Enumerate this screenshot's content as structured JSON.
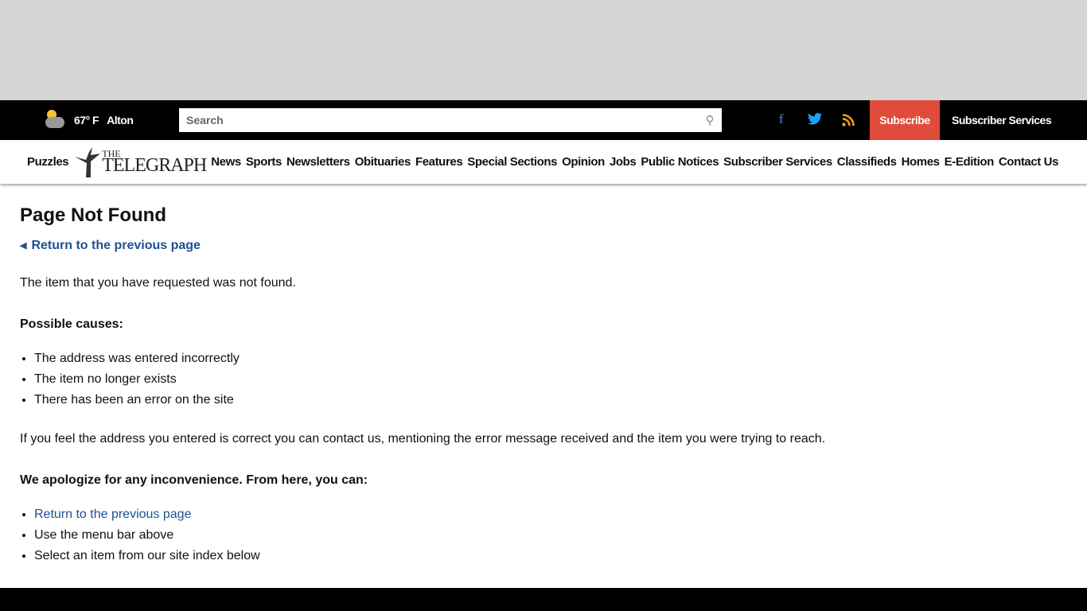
{
  "topbar": {
    "temperature": "67° F",
    "city": "Alton",
    "search_placeholder": "Search",
    "subscribe": "Subscribe",
    "subscriber_services": "Subscriber Services",
    "social": {
      "facebook": "f",
      "twitter": "twitter-icon",
      "rss": "rss-icon"
    },
    "colors": {
      "subscribe_bg": "#e14b3b",
      "facebook": "#3b5998",
      "twitter": "#1da1f2",
      "rss": "#f39c12"
    }
  },
  "nav": {
    "logo_line1": "THE",
    "logo_line2": "TELEGRAPH",
    "puzzles": "Puzzles",
    "items": [
      "News",
      "Sports",
      "Newsletters",
      "Obituaries",
      "Features",
      "Special Sections",
      "Opinion",
      "Jobs",
      "Public Notices",
      "Subscriber Services",
      "Classifieds",
      "Homes",
      "E-Edition",
      "Contact Us"
    ]
  },
  "main": {
    "title": "Page Not Found",
    "back_link": "Return to the previous page",
    "intro": "The item that you have requested was not found.",
    "causes_heading": "Possible causes:",
    "causes": [
      "The address was entered incorrectly",
      "The item no longer exists",
      "There has been an error on the site"
    ],
    "contact_text": "If you feel the address you entered is correct you can contact us, mentioning the error message received and the item you were trying to reach.",
    "apology": "We apologize for any inconvenience. From here, you can:",
    "options": [
      "Return to the previous page",
      "Use the menu bar above",
      "Select an item from our site index below"
    ]
  }
}
